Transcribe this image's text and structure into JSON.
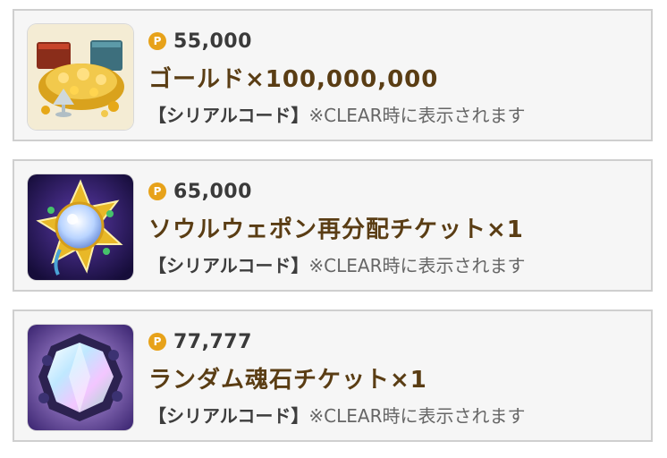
{
  "colors": {
    "card_bg": "#f6f6f6",
    "card_border": "#cfcfcf",
    "coin": "#e7a21a",
    "item_name": "#5a3d14",
    "note": "#666666"
  },
  "items": [
    {
      "coin_symbol": "P",
      "price": "55,000",
      "name": "ゴールド×100,000,000",
      "code_label": "【シリアルコード】",
      "code_note": "※CLEAR時に表示されます",
      "icon": "gold-treasure-icon"
    },
    {
      "coin_symbol": "P",
      "price": "65,000",
      "name": "ソウルウェポン再分配チケット×1",
      "code_label": "【シリアルコード】",
      "code_note": "※CLEAR時に表示されます",
      "icon": "soul-weapon-ticket-icon"
    },
    {
      "coin_symbol": "P",
      "price": "77,777",
      "name": "ランダム魂石チケット×1",
      "code_label": "【シリアルコード】",
      "code_note": "※CLEAR時に表示されます",
      "icon": "soul-stone-ticket-icon"
    }
  ]
}
